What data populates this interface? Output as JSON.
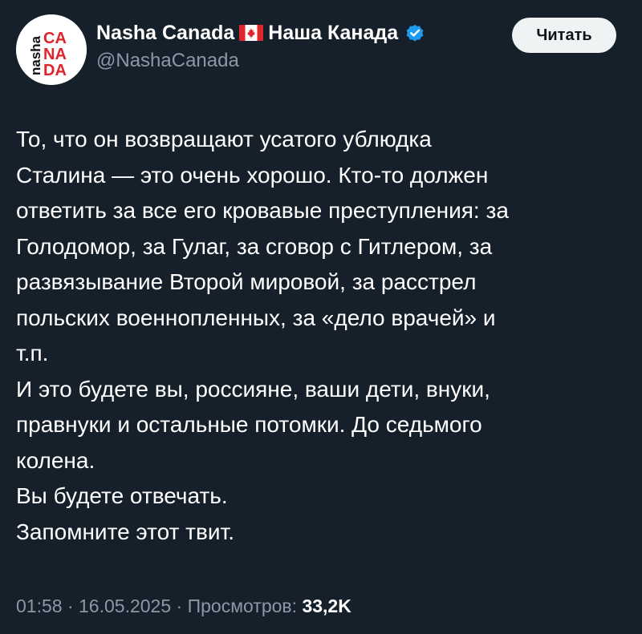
{
  "tweet": {
    "author": {
      "display_name_latin": "Nasha Canada",
      "display_name_cyrillic": "Наша Канада",
      "handle": "@NashaCanada",
      "avatar_text": {
        "side": "nasha",
        "line1": "CA",
        "line2": "NA",
        "line3": "DA"
      },
      "verified": true
    },
    "follow_label": "Читать",
    "text": "То, что он возвращают усатого ублюдка\nСталина — это очень хорошо. Кто-то должен\nответить за все его кровавые преступления: за\nГолодомор, за Гулаг, за сговор с Гитлером, за\nразвязывание Второй мировой, за расстрел\nпольских военнопленных, за «дело врачей» и\nт.п.\nИ это будете вы, россияне, ваши дети, внуки,\nправнуки и остальные потомки. До седьмого\nколена.\nВы будете отвечать.\nЗапомните этот твит.",
    "time": "01:58",
    "date": "16.05.2025",
    "separator": "·",
    "views_label": "Просмотров:",
    "views_count": "33,2K"
  },
  "colors": {
    "background": "#15202b",
    "text": "#ffffff",
    "secondary_text": "#8b98a5",
    "verified_badge": "#1d9bf0",
    "avatar_red": "#e0242b",
    "button_bg": "#eff3f4",
    "button_text": "#0f1419"
  },
  "icons": {
    "flag": "canada-flag-icon",
    "verified": "verified-badge-icon"
  }
}
